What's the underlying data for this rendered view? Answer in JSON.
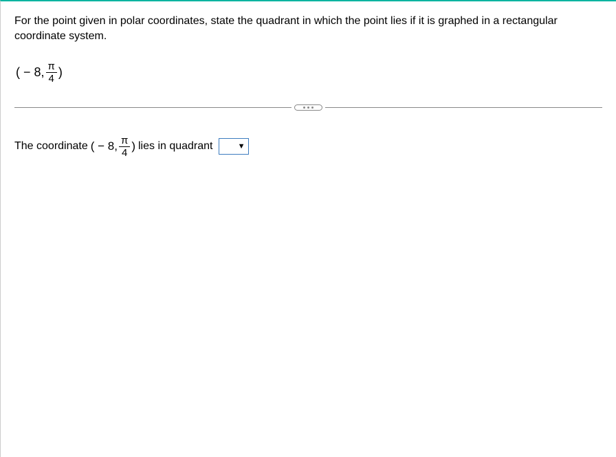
{
  "question": {
    "prompt": "For the point given in polar coordinates, state the quadrant in which the point lies if it is graphed in a rectangular coordinate system.",
    "coord_prefix": "( − 8,",
    "coord_frac_num": "π",
    "coord_frac_den": "4",
    "coord_suffix": ")"
  },
  "answer": {
    "text_before": "The coordinate",
    "coord_prefix": "( − 8,",
    "coord_frac_num": "π",
    "coord_frac_den": "4",
    "coord_suffix": ")",
    "text_after": "lies in quadrant",
    "selected": ""
  }
}
